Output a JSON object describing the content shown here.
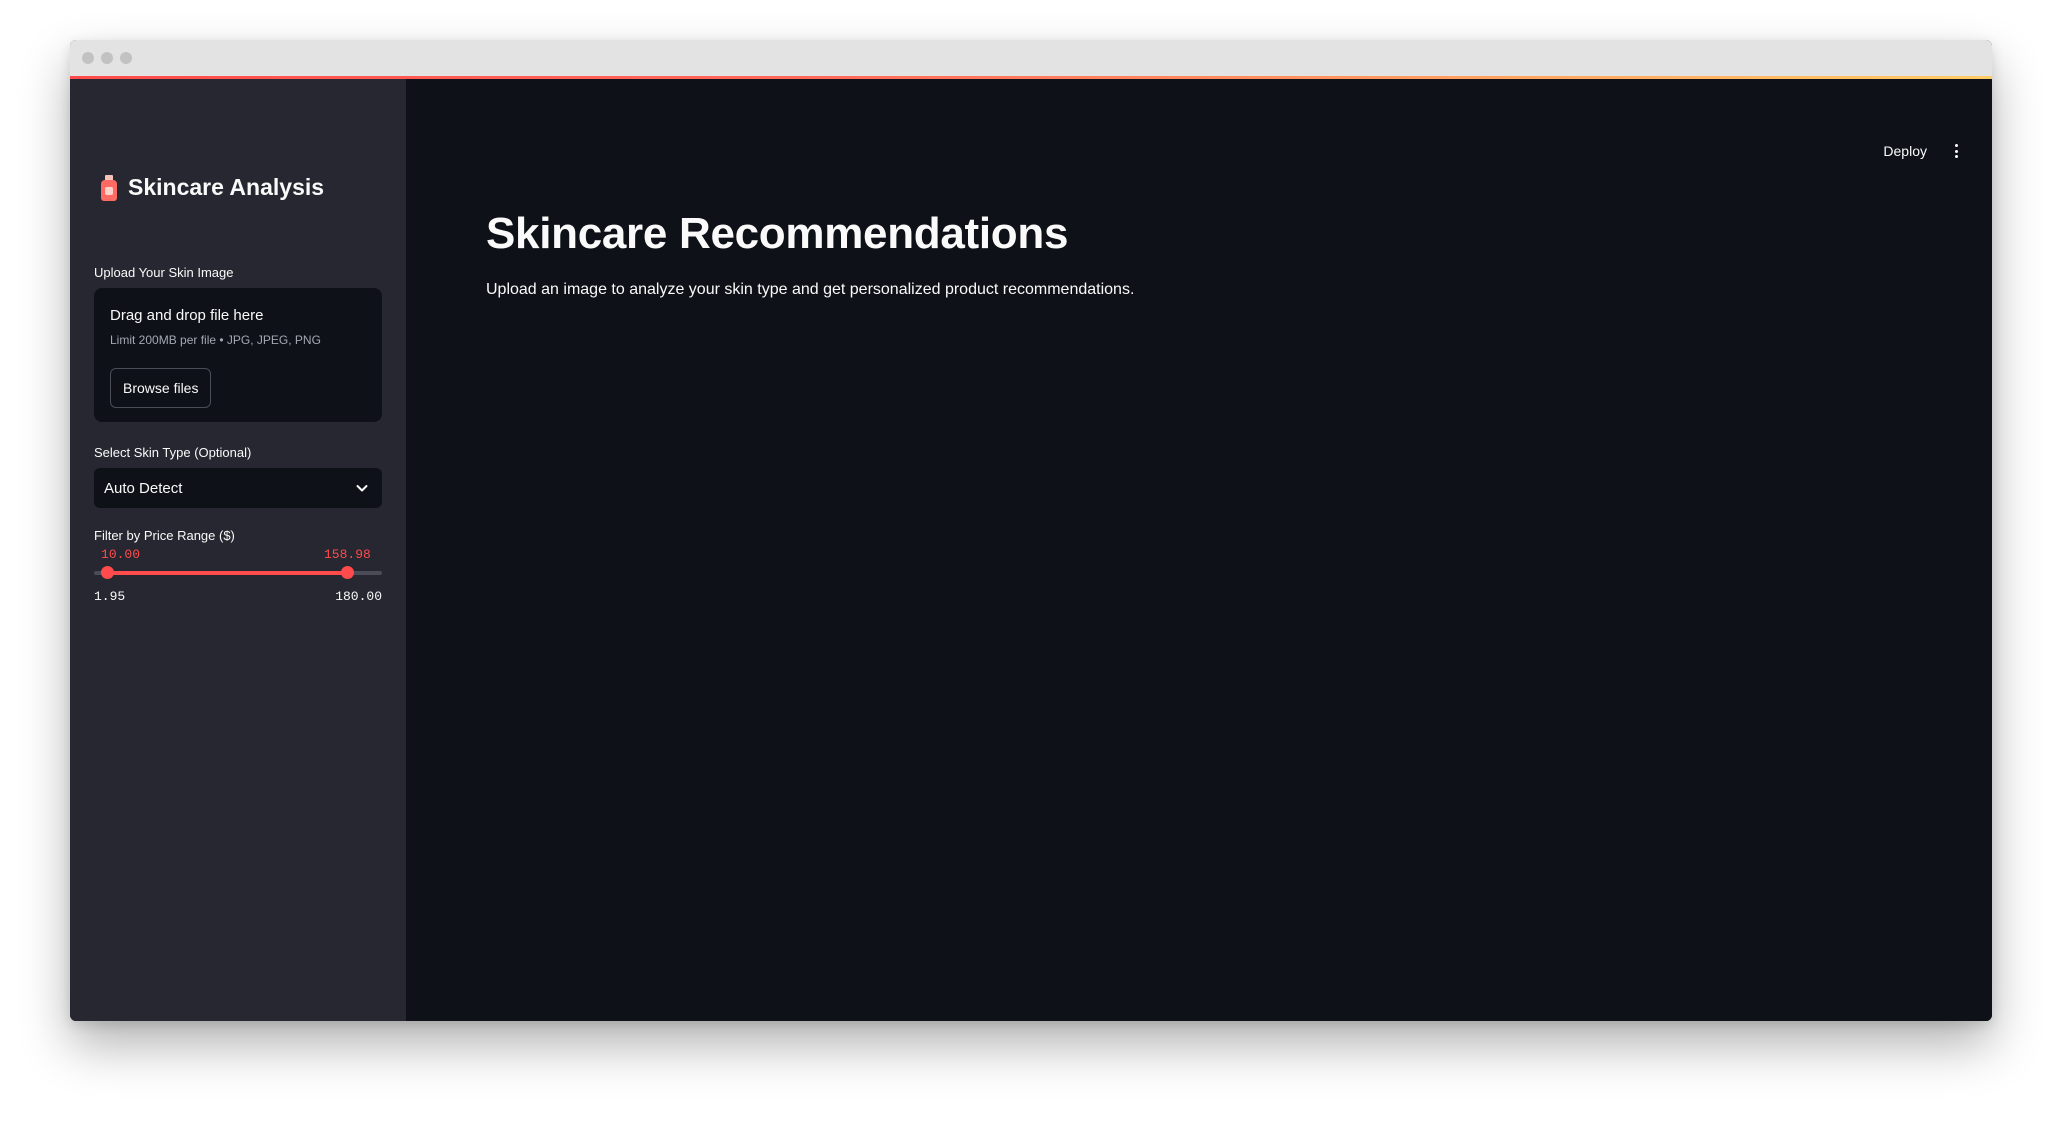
{
  "window": {
    "accent_colors": [
      "#ff4b4b",
      "#ffcc66"
    ]
  },
  "sidebar": {
    "title": "Skincare Analysis",
    "title_icon": "lotion-bottle-icon",
    "uploader": {
      "label": "Upload Your Skin Image",
      "drop_text": "Drag and drop file here",
      "limit_text": "Limit 200MB per file • JPG, JPEG, PNG",
      "browse_label": "Browse files"
    },
    "skin_type": {
      "label": "Select Skin Type (Optional)",
      "selected": "Auto Detect"
    },
    "price_range": {
      "label": "Filter by Price Range ($)",
      "low": "10.00",
      "high": "158.98",
      "min": "1.95",
      "max": "180.00",
      "low_value": 10.0,
      "high_value": 158.98,
      "min_value": 1.95,
      "max_value": 180.0
    }
  },
  "header": {
    "deploy_label": "Deploy",
    "menu_icon": "kebab-menu-icon"
  },
  "main": {
    "title": "Skincare Recommendations",
    "subtitle": "Upload an image to analyze your skin type and get personalized product recommendations."
  },
  "colors": {
    "sidebar_bg": "#262730",
    "main_bg": "#0e1117",
    "accent": "#ff4b4b",
    "text": "#fafafa"
  }
}
